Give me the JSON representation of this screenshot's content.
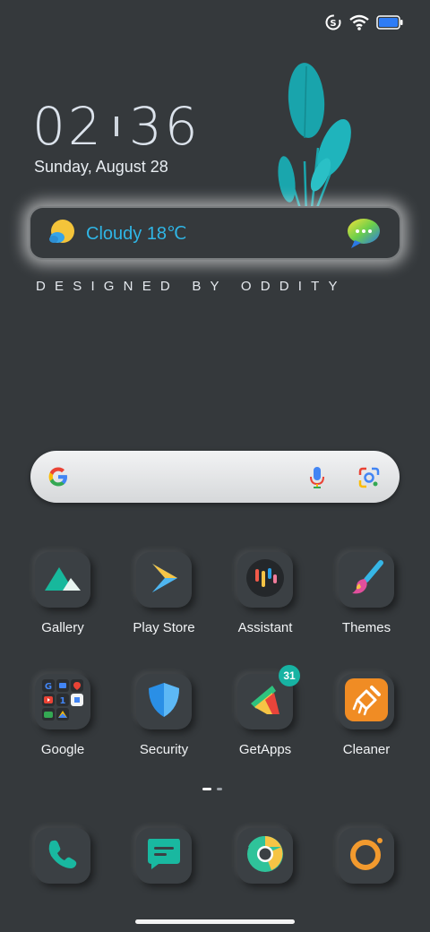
{
  "status": {
    "data_saver_icon": "data-saver-icon",
    "wifi_icon": "wifi-icon",
    "battery_icon": "battery-icon"
  },
  "clock": {
    "hours": "02",
    "minutes": "36"
  },
  "date": "Sunday, August 28",
  "weather": {
    "text": "Cloudy 18℃",
    "icon": "partly-cloudy-icon"
  },
  "tagline": "DESIGNED BY ODDITY",
  "search": {
    "icons": [
      "google-g-icon",
      "microphone-icon",
      "google-lens-icon"
    ]
  },
  "apps": [
    {
      "label": "Gallery",
      "icon": "gallery-icon"
    },
    {
      "label": "Play Store",
      "icon": "play-store-icon"
    },
    {
      "label": "Assistant",
      "icon": "assistant-icon"
    },
    {
      "label": "Themes",
      "icon": "themes-brush-icon"
    },
    {
      "label": "Google",
      "icon": "google-folder-icon"
    },
    {
      "label": "Security",
      "icon": "security-shield-icon"
    },
    {
      "label": "GetApps",
      "icon": "getapps-icon",
      "badge": "31"
    },
    {
      "label": "Cleaner",
      "icon": "cleaner-broom-icon"
    }
  ],
  "dock": [
    {
      "icon": "phone-icon"
    },
    {
      "icon": "messages-icon"
    },
    {
      "icon": "chrome-icon"
    },
    {
      "icon": "camera-icon"
    }
  ],
  "colors": {
    "background": "#35393c",
    "accent_teal": "#17b3a3",
    "weather_text": "#2fb6e6"
  }
}
